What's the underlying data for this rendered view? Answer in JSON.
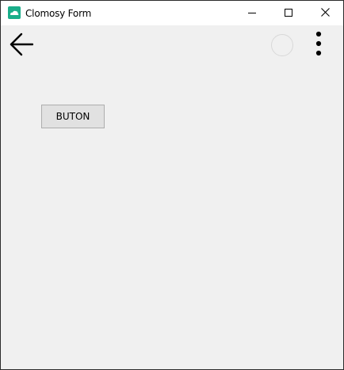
{
  "window": {
    "title": "Clomosy Form",
    "app_icon": "clomosy-logo-icon",
    "accent_color": "#1aae8a",
    "caption_buttons": {
      "minimize": "minimize-icon",
      "maximize": "maximize-icon",
      "close": "close-icon"
    }
  },
  "toolbar": {
    "back_icon": "arrow-left-icon",
    "status_icon": "circle-icon",
    "menu_icon": "more-vertical-icon"
  },
  "main": {
    "button_label": "BUTON"
  }
}
